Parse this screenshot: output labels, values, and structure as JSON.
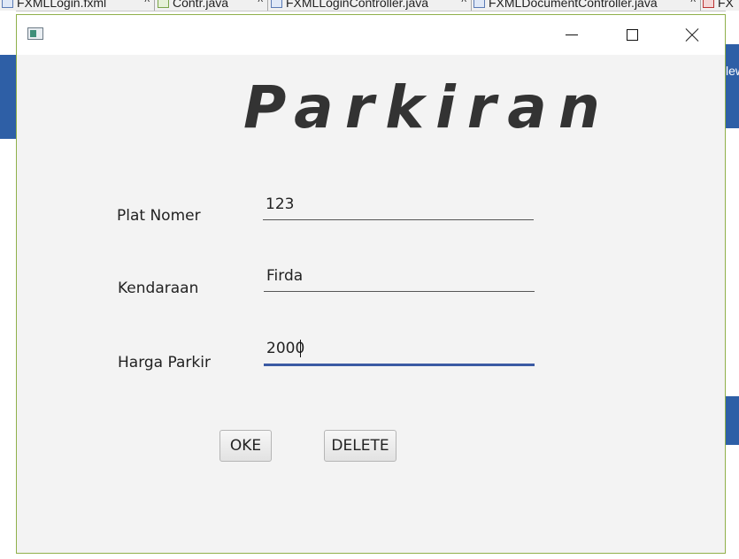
{
  "ide": {
    "tabs": [
      {
        "label": "FXMLLogin.fxml",
        "close": "^"
      },
      {
        "label": "Contr.java",
        "close": "^"
      },
      {
        "label": "FXMLLoginController.java",
        "close": "^"
      },
      {
        "label": "FXMLDocumentController.java",
        "close": "^"
      },
      {
        "label": "FX"
      }
    ],
    "right_text": "lew"
  },
  "window": {
    "icon": "app-window-icon",
    "controls": {
      "minimize": "minimize-icon",
      "maximize": "maximize-icon",
      "close": "close-icon"
    }
  },
  "form": {
    "title": "Parkiran",
    "fields": [
      {
        "label": "Plat Nomer",
        "value": "123"
      },
      {
        "label": "Kendaraan",
        "value": "Firda"
      },
      {
        "label": "Harga Parkir",
        "value": "2000"
      }
    ],
    "buttons": {
      "ok": "OKE",
      "delete": "DELETE"
    }
  },
  "colors": {
    "focus_accent": "#3b5aa3",
    "window_border": "#8fb04a",
    "ide_blue": "#2e5fa6"
  }
}
